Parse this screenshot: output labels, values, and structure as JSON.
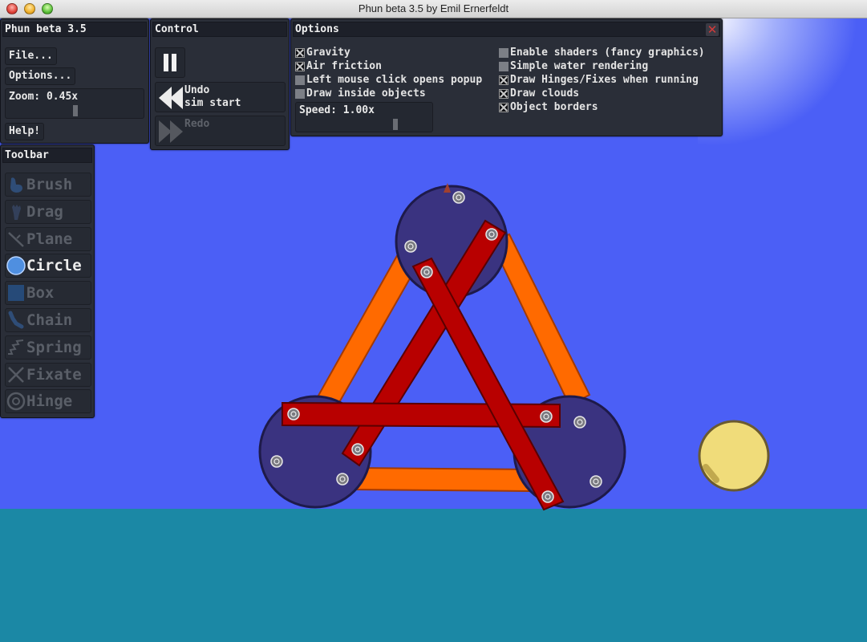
{
  "window": {
    "title": "Phun beta 3.5 by Emil Ernerfeldt"
  },
  "main_panel": {
    "title": "Phun beta 3.5",
    "file_label": "File...",
    "options_label": "Options...",
    "zoom_label": "Zoom: 0.45x",
    "zoom_value": 0.45,
    "help_label": "Help!"
  },
  "control_panel": {
    "title": "Control",
    "pause_icon": "pause-icon",
    "undo_label_line1": "Undo",
    "undo_label_line2": "sim start",
    "redo_label": "Redo"
  },
  "options_panel": {
    "title": "Options",
    "left_options": [
      {
        "label": "Gravity",
        "checked": true
      },
      {
        "label": "Air friction",
        "checked": true
      },
      {
        "label": "Left mouse click opens popup",
        "checked": false
      },
      {
        "label": "Draw inside objects",
        "checked": false
      }
    ],
    "right_options": [
      {
        "label": "Enable shaders (fancy graphics)",
        "checked": false
      },
      {
        "label": "Simple water rendering",
        "checked": false
      },
      {
        "label": "Draw Hinges/Fixes when running",
        "checked": true
      },
      {
        "label": "Draw clouds",
        "checked": true
      },
      {
        "label": "Object borders",
        "checked": true
      }
    ],
    "speed_label": "Speed: 1.00x",
    "speed_value": 1.0
  },
  "toolbar": {
    "title": "Toolbar",
    "tools": [
      {
        "label": "Brush",
        "icon": "brush-icon",
        "active": false
      },
      {
        "label": "Drag",
        "icon": "drag-hand-icon",
        "active": false
      },
      {
        "label": "Plane",
        "icon": "plane-icon",
        "active": false
      },
      {
        "label": "Circle",
        "icon": "circle-icon",
        "active": true
      },
      {
        "label": "Box",
        "icon": "box-icon",
        "active": false
      },
      {
        "label": "Chain",
        "icon": "chain-icon",
        "active": false
      },
      {
        "label": "Spring",
        "icon": "spring-icon",
        "active": false
      },
      {
        "label": "Fixate",
        "icon": "fixate-icon",
        "active": false
      },
      {
        "label": "Hinge",
        "icon": "hinge-icon",
        "active": false
      }
    ]
  },
  "colors": {
    "sky": "#4b5ff6",
    "water": "#1b88a5",
    "wheel": "#3a3380",
    "orange_bar": "#ff6a00",
    "red_bar": "#b80000",
    "ball": "#f0dc7a"
  }
}
